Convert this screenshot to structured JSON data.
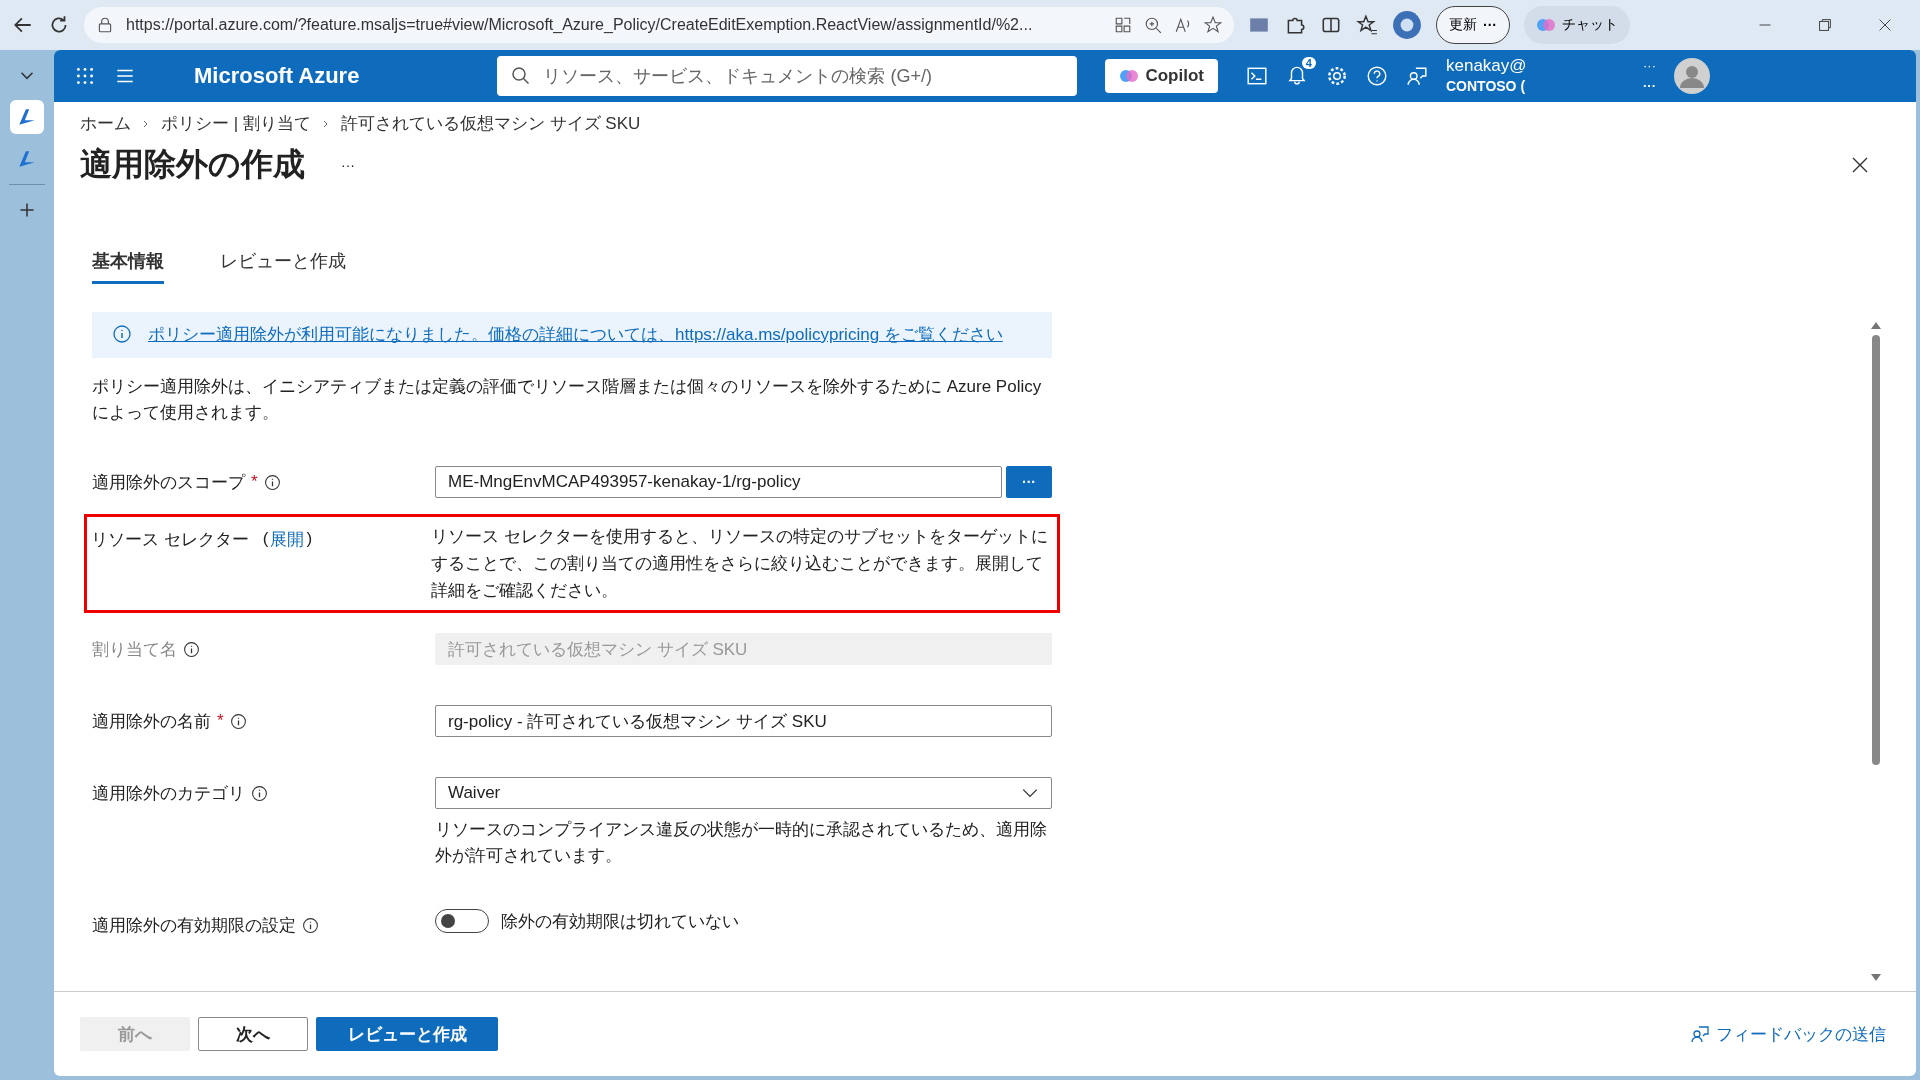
{
  "browser": {
    "url": "https://portal.azure.com/?feature.msaljs=true#view/Microsoft_Azure_Policy/CreateEditExemption.ReactView/assignmentId/%2...",
    "update_button": "更新",
    "update_more": "···",
    "chat_button": "チャット"
  },
  "header": {
    "brand": "Microsoft Azure",
    "search_placeholder": "リソース、サービス、ドキュメントの検索 (G+/)",
    "copilot": "Copilot",
    "notification_count": "4",
    "user_name": "kenakay@",
    "user_tenant": "CONTOSO (",
    "user_more_1": "···",
    "user_more_2": "···"
  },
  "breadcrumb": [
    "ホーム",
    "ポリシー | 割り当て",
    "許可されている仮想マシン サイズ SKU"
  ],
  "page": {
    "title": "適用除外の作成",
    "more": "···"
  },
  "tabs": [
    {
      "label": "基本情報",
      "selected": true
    },
    {
      "label": "レビューと作成",
      "selected": false
    }
  ],
  "info_banner": "ポリシー適用除外が利用可能になりました。価格の詳細については、https://aka.ms/policypricing をご覧ください",
  "description": "ポリシー適用除外は、イニシアティブまたは定義の評価でリソース階層または個々のリソースを除外するために Azure Policy によって使用されます。",
  "form": [
    {
      "kind": "picker",
      "label": "適用除外のスコープ",
      "required_mark": "*",
      "info": true,
      "value": "ME-MngEnvMCAP493957-kenakay-1/rg-policy",
      "button": "···"
    },
    {
      "kind": "selector",
      "label": "リソース セレクター",
      "link_open": "(",
      "link": "展開",
      "link_close": ")",
      "highlighted": true,
      "text": "リソース セレクターを使用すると、リソースの特定のサブセットをターゲットにすることで、この割り当ての適用性をさらに絞り込むことができます。展開して詳細をご確認ください。"
    },
    {
      "kind": "text",
      "label": "割り当て名",
      "info": true,
      "disabled": true,
      "value": "許可されている仮想マシン サイズ SKU"
    },
    {
      "kind": "text",
      "label": "適用除外の名前",
      "required_mark": "*",
      "info": true,
      "disabled": false,
      "value": "rg-policy - 許可されている仮想マシン サイズ SKU"
    },
    {
      "kind": "dropdown",
      "label": "適用除外のカテゴリ",
      "info": true,
      "value": "Waiver",
      "help": "リソースのコンプライアンス違反の状態が一時的に承認されているため、適用除外が許可されています。"
    },
    {
      "kind": "toggle",
      "label": "適用除外の有効期限の設定",
      "info": true,
      "on": false,
      "text": "除外の有効期限は切れていない"
    }
  ],
  "footer": {
    "buttons": [
      {
        "label": "前へ",
        "kind": "secondary",
        "disabled": true
      },
      {
        "label": "次へ",
        "kind": "secondary",
        "disabled": false
      },
      {
        "label": "レビューと作成",
        "kind": "primary",
        "disabled": false
      }
    ],
    "feedback": "フィードバックの送信"
  }
}
